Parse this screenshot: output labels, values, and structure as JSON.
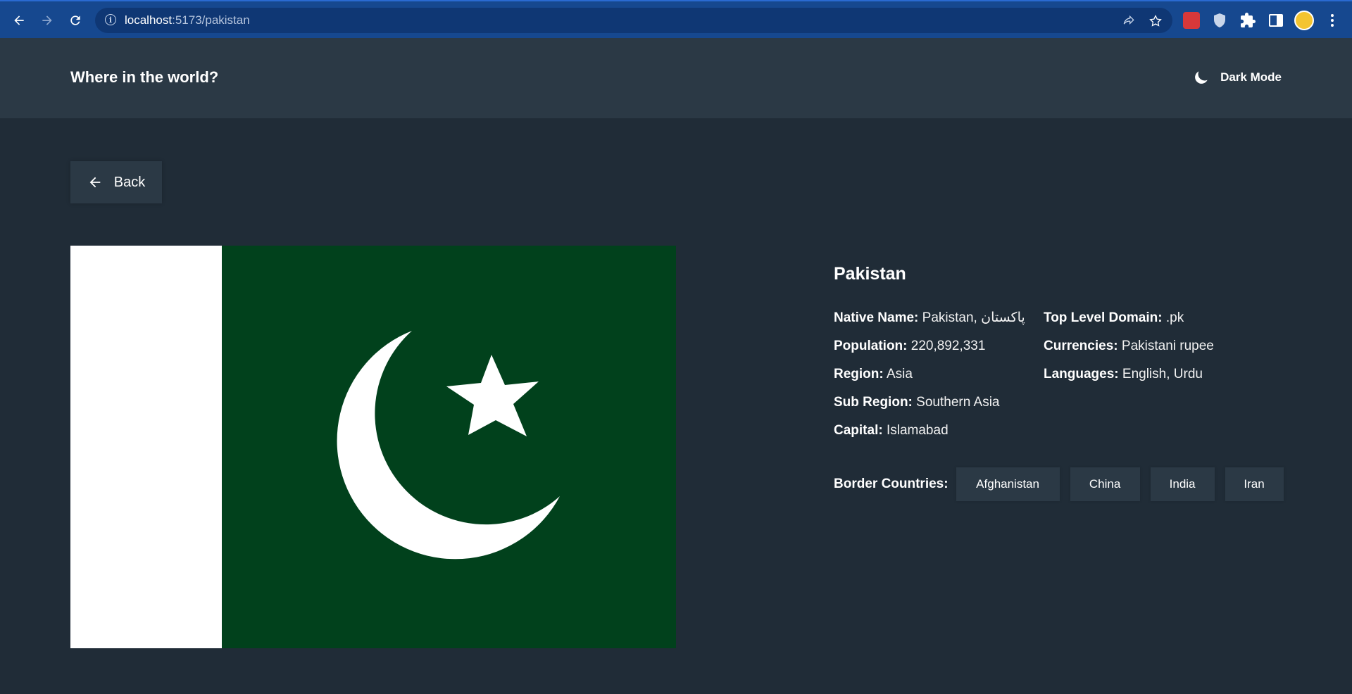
{
  "browser": {
    "url_host": "localhost",
    "url_path": ":5173/pakistan"
  },
  "header": {
    "title": "Where in the world?",
    "theme_toggle_label": "Dark Mode",
    "theme_icon": "moon-icon"
  },
  "back_button": {
    "label": "Back",
    "icon": "arrow-left-icon"
  },
  "flag": {
    "alt": "Flag of Pakistan",
    "colors": {
      "green": "#01411c",
      "white": "#ffffff"
    }
  },
  "country": {
    "name": "Pakistan",
    "left_column": [
      {
        "label": "Native Name:",
        "value": "Pakistan, پاکستان"
      },
      {
        "label": "Population:",
        "value": "220,892,331"
      },
      {
        "label": "Region:",
        "value": "Asia"
      },
      {
        "label": "Sub Region:",
        "value": "Southern Asia"
      },
      {
        "label": "Capital:",
        "value": "Islamabad"
      }
    ],
    "right_column": [
      {
        "label": "Top Level Domain:",
        "value": ".pk"
      },
      {
        "label": "Currencies:",
        "value": "Pakistani rupee"
      },
      {
        "label": "Languages:",
        "value": "English, Urdu"
      }
    ],
    "border_label": "Border Countries:",
    "borders": [
      "Afghanistan",
      "China",
      "India",
      "Iran"
    ]
  },
  "colors": {
    "background": "#202c37",
    "elements": "#2b3945",
    "browser_bar": "#16488f"
  }
}
